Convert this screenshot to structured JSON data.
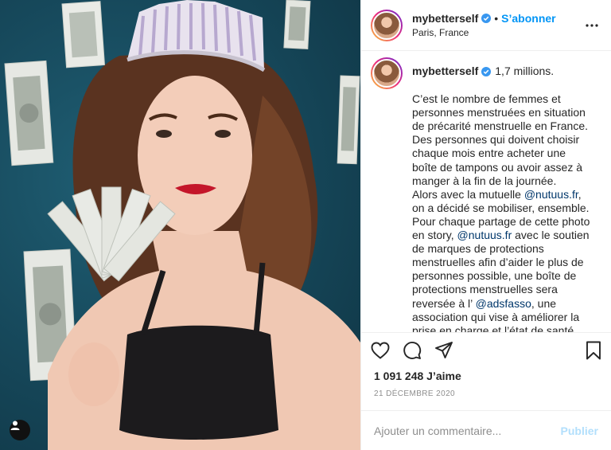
{
  "post": {
    "username": "mybetterself",
    "follow_label": "S’abonner",
    "separator": "•",
    "location": "Paris, France",
    "caption": {
      "username": "mybetterself",
      "title": "1,7 millions.",
      "p1": "C’est le nombre de femmes et personnes menstruées en situation de précarité menstruelle en France. Des personnes qui doivent choisir chaque mois entre acheter une boîte de tampons ou avoir assez à manger à la fin de la journée.",
      "p2_a": "Alors avec la mutuelle ",
      "mention_1": "@nutuus.fr",
      "p2_b": ", on a décidé se mobiliser, ensemble. Pour chaque partage de cette photo en story, ",
      "mention_2": "@nutuus.fr",
      "p2_c": " avec le soutien de marques de protections menstruelles afin d’aider le plus de personnes possible, une boîte de protections menstruelles sera reversée à l’ ",
      "mention_3": "@adsfasso",
      "p2_d": ", une association qui vise à améliorer la prise en charge et l’état de santé des femmes et personnes menstruées en"
    },
    "likes": "1 091 248 J’aime",
    "date": "21 DÉCEMBRE 2020",
    "comment_placeholder": "Ajouter un commentaire...",
    "publish_label": "Publier"
  },
  "icons": {
    "verified": "verified-badge-icon",
    "more": "more-options-icon",
    "like": "heart-icon",
    "comment": "comment-bubble-icon",
    "share": "paper-plane-icon",
    "save": "bookmark-icon",
    "user_tags": "user-tag-icon"
  },
  "colors": {
    "accent": "#0095f6",
    "mention": "#00376b",
    "muted": "#8e8e8e",
    "publish_disabled": "#b2dffc"
  }
}
